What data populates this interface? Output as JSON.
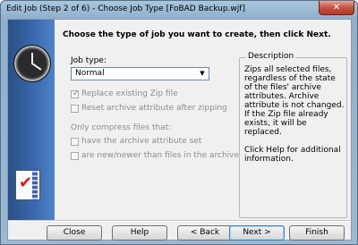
{
  "window": {
    "title": "Edit Job (Step 2 of 6) - Choose Job Type [FoBAD Backup.wjf]",
    "close_glyph": "✕"
  },
  "page": {
    "heading": "Choose the type of job you want to create, then click Next."
  },
  "job_type": {
    "label": "Job type:",
    "selected": "Normal"
  },
  "options": {
    "replace_existing": {
      "label": "Replace existing Zip file",
      "checked": true,
      "enabled": false
    },
    "reset_archive": {
      "label": "Reset archive attribute after zipping",
      "checked": false,
      "enabled": false
    },
    "only_compress_label": "Only compress files that:",
    "archive_attr_set": {
      "label": "have the archive attribute set",
      "checked": false,
      "enabled": false
    },
    "newer_than_archive": {
      "label": "are new/newer than files in the archive",
      "checked": false,
      "enabled": false
    }
  },
  "description": {
    "title": "Description",
    "text1": "Zips all selected files, regardless of the state of the files' archive attributes. Archive attribute is not changed.  If the Zip file already exists, it will be replaced.",
    "text2": "Click Help for additional information."
  },
  "buttons": {
    "close": "Close",
    "help": "Help",
    "back": "< Back",
    "next": "Next >",
    "finish": "Finish"
  },
  "icons": [
    "clock-icon",
    "zip-checklist-icon",
    "dropdown-arrow-icon",
    "close-icon"
  ]
}
